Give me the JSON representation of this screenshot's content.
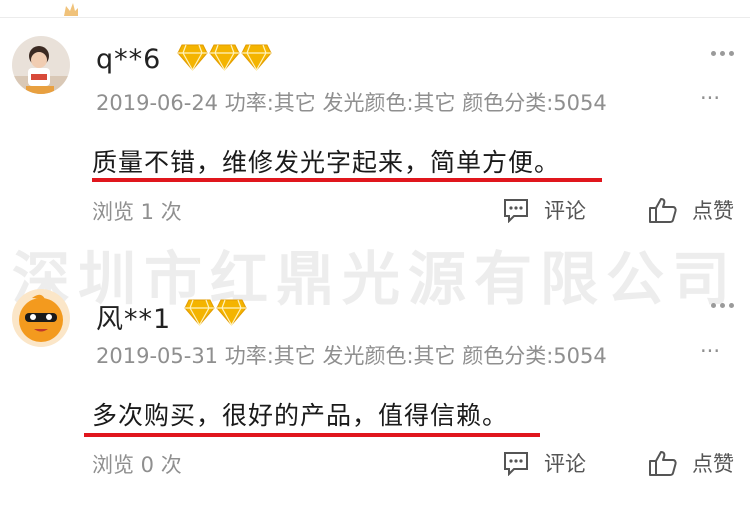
{
  "watermark": "深圳市红鼎光源有限公司",
  "icons": {
    "more": "more-dots-icon",
    "comment": "comment-icon",
    "like": "thumbs-up-icon",
    "badge": "diamond-badge-icon"
  },
  "colors": {
    "underline": "#e0161d",
    "badge": "#f4b400",
    "meta": "#8f8f8f"
  },
  "reviews": [
    {
      "username": "q**6",
      "badge_count": 3,
      "meta": "2019-06-24 功率:其它 发光颜色:其它 颜色分类:5054",
      "meta_ellipsis": "···",
      "content": "质量不错，维修发光字起来，简单方便。",
      "views": "浏览 1 次",
      "comment_label": "评论",
      "like_label": "点赞"
    },
    {
      "username": "风**1",
      "badge_count": 2,
      "meta": "2019-05-31 功率:其它 发光颜色:其它 颜色分类:5054",
      "meta_ellipsis": "···",
      "content": "多次购买，很好的产品，值得信赖。",
      "views": "浏览 0 次",
      "comment_label": "评论",
      "like_label": "点赞"
    }
  ]
}
